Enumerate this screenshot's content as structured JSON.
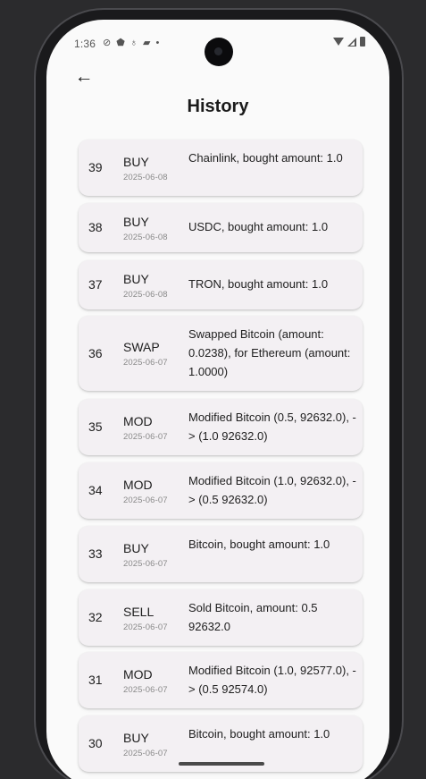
{
  "status_bar": {
    "time": "1:36",
    "left_icons": [
      "shield-icon",
      "shield-icon",
      "accessibility-icon",
      "sd-card-icon",
      "dot-icon"
    ],
    "right_icons": [
      "wifi-icon",
      "signal-icon",
      "battery-icon"
    ]
  },
  "header": {
    "back_icon": "arrow-left-icon",
    "title": "History"
  },
  "history": [
    {
      "id": "39",
      "type": "BUY",
      "date": "2025-06-08",
      "desc": "Chainlink, bought amount: 1.0"
    },
    {
      "id": "38",
      "type": "BUY",
      "date": "2025-06-08",
      "desc": "USDC, bought amount: 1.0"
    },
    {
      "id": "37",
      "type": "BUY",
      "date": "2025-06-08",
      "desc": "TRON, bought amount: 1.0"
    },
    {
      "id": "36",
      "type": "SWAP",
      "date": "2025-06-07",
      "desc": "Swapped Bitcoin (amount: 0.0238), for Ethereum (amount: 1.0000)"
    },
    {
      "id": "35",
      "type": "MOD",
      "date": "2025-06-07",
      "desc": "Modified Bitcoin (0.5, 92632.0), -> (1.0 92632.0)"
    },
    {
      "id": "34",
      "type": "MOD",
      "date": "2025-06-07",
      "desc": "Modified Bitcoin (1.0, 92632.0), -> (0.5 92632.0)"
    },
    {
      "id": "33",
      "type": "BUY",
      "date": "2025-06-07",
      "desc": "Bitcoin, bought amount: 1.0"
    },
    {
      "id": "32",
      "type": "SELL",
      "date": "2025-06-07",
      "desc": "Sold Bitcoin, amount: 0.5 92632.0"
    },
    {
      "id": "31",
      "type": "MOD",
      "date": "2025-06-07",
      "desc": "Modified Bitcoin (1.0, 92577.0), -> (0.5 92574.0)"
    },
    {
      "id": "30",
      "type": "BUY",
      "date": "2025-06-07",
      "desc": "Bitcoin, bought amount: 1.0"
    }
  ],
  "colors": {
    "background": "#fafafa",
    "card": "#f3f0f3",
    "text": "#202020",
    "date": "#8a8a8a"
  }
}
